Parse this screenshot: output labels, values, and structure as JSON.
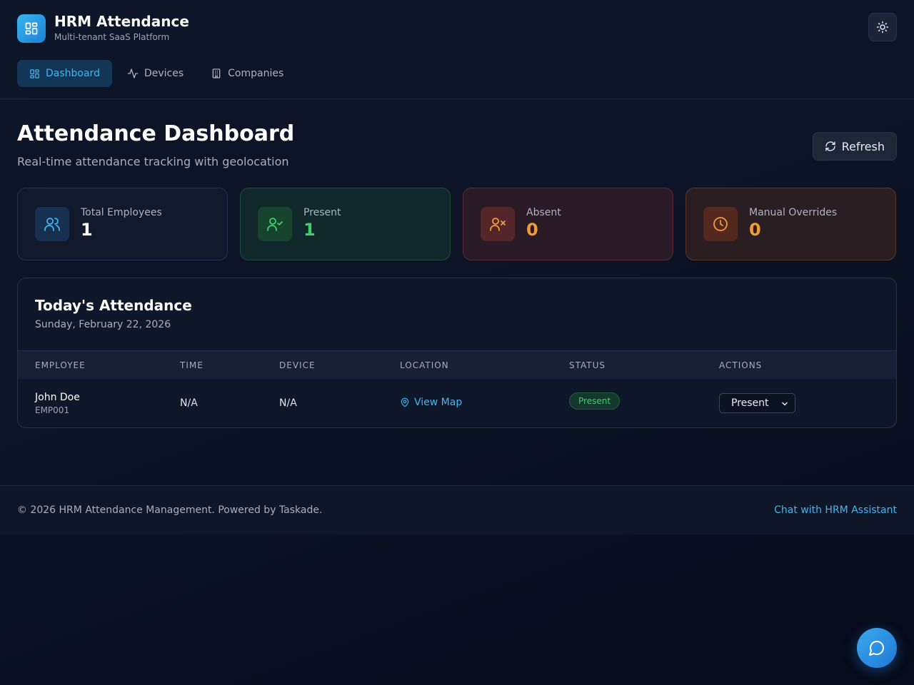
{
  "app": {
    "title": "HRM Attendance",
    "subtitle": "Multi-tenant SaaS Platform",
    "logo_icon": "dashboard-grid-icon",
    "theme_icon": "sun-icon"
  },
  "nav": {
    "tabs": [
      {
        "label": "Dashboard",
        "icon": "dashboard-grid-icon",
        "active": true
      },
      {
        "label": "Devices",
        "icon": "activity-icon",
        "active": false
      },
      {
        "label": "Companies",
        "icon": "building-icon",
        "active": false
      }
    ]
  },
  "page": {
    "title": "Attendance Dashboard",
    "subtitle": "Real-time attendance tracking with geolocation",
    "refresh_label": "Refresh"
  },
  "stats": [
    {
      "label": "Total Employees",
      "value": "1",
      "icon": "users-icon",
      "accent": "#3fb7f2"
    },
    {
      "label": "Present",
      "value": "1",
      "icon": "user-check-icon",
      "accent": "#3ecf6e"
    },
    {
      "label": "Absent",
      "value": "0",
      "icon": "user-x-icon",
      "accent": "#f09a3a"
    },
    {
      "label": "Manual Overrides",
      "value": "0",
      "icon": "clock-icon",
      "accent": "#f09a3a"
    }
  ],
  "attendance": {
    "title": "Today's Attendance",
    "date": "Sunday, February 22, 2026",
    "columns": [
      "EMPLOYEE",
      "TIME",
      "DEVICE",
      "LOCATION",
      "STATUS",
      "ACTIONS"
    ],
    "rows": [
      {
        "name": "John Doe",
        "id": "EMP001",
        "time": "N/A",
        "device": "N/A",
        "location_link": "View Map",
        "status": "Present",
        "action_value": "Present"
      }
    ]
  },
  "footer": {
    "text": "© 2026 HRM Attendance Management. Powered by Taskade.",
    "link": "Chat with HRM Assistant"
  },
  "colors": {
    "accent": "#3fb7f2",
    "success": "#3ecf6e",
    "warning": "#f09a3a"
  }
}
